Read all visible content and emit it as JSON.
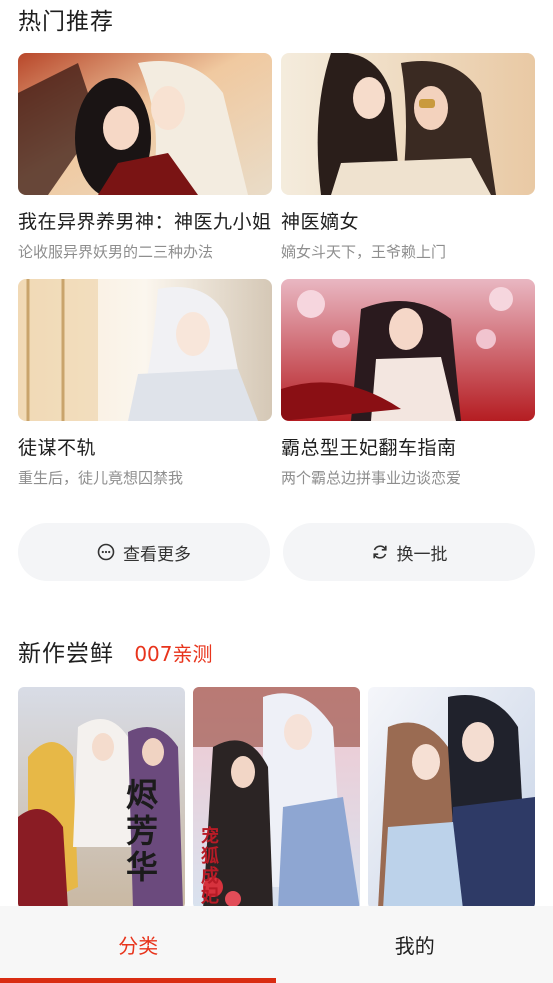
{
  "hot_section": {
    "title": "热门推荐",
    "items": [
      {
        "title": "我在异界养男神：神医九小姐",
        "subtitle": "论收服异界妖男的二三种办法"
      },
      {
        "title": "神医嫡女",
        "subtitle": "嫡女斗天下，王爷赖上门"
      },
      {
        "title": "徒谋不轨",
        "subtitle": "重生后，徒儿竟想囚禁我"
      },
      {
        "title": "霸总型王妃翻车指南",
        "subtitle": "两个霸总边拼事业边谈恋爱"
      }
    ],
    "more_button": {
      "label": "查看更多",
      "icon": "more-dots-icon"
    },
    "refresh_button": {
      "label": "换一批",
      "icon": "refresh-icon"
    }
  },
  "new_section": {
    "title": "新作尝鲜",
    "tag": "007亲测",
    "covers": [
      {
        "cover_text": "烬芳华"
      },
      {
        "cover_text": "宠狐成妃"
      },
      {
        "cover_text": ""
      }
    ]
  },
  "tabbar": {
    "tabs": [
      {
        "label": "分类",
        "active": true
      },
      {
        "label": "我的",
        "active": false
      }
    ]
  },
  "colors": {
    "accent": "#e8341c",
    "muted_text": "#8e8e8e",
    "pill_bg": "#f4f5f7"
  }
}
